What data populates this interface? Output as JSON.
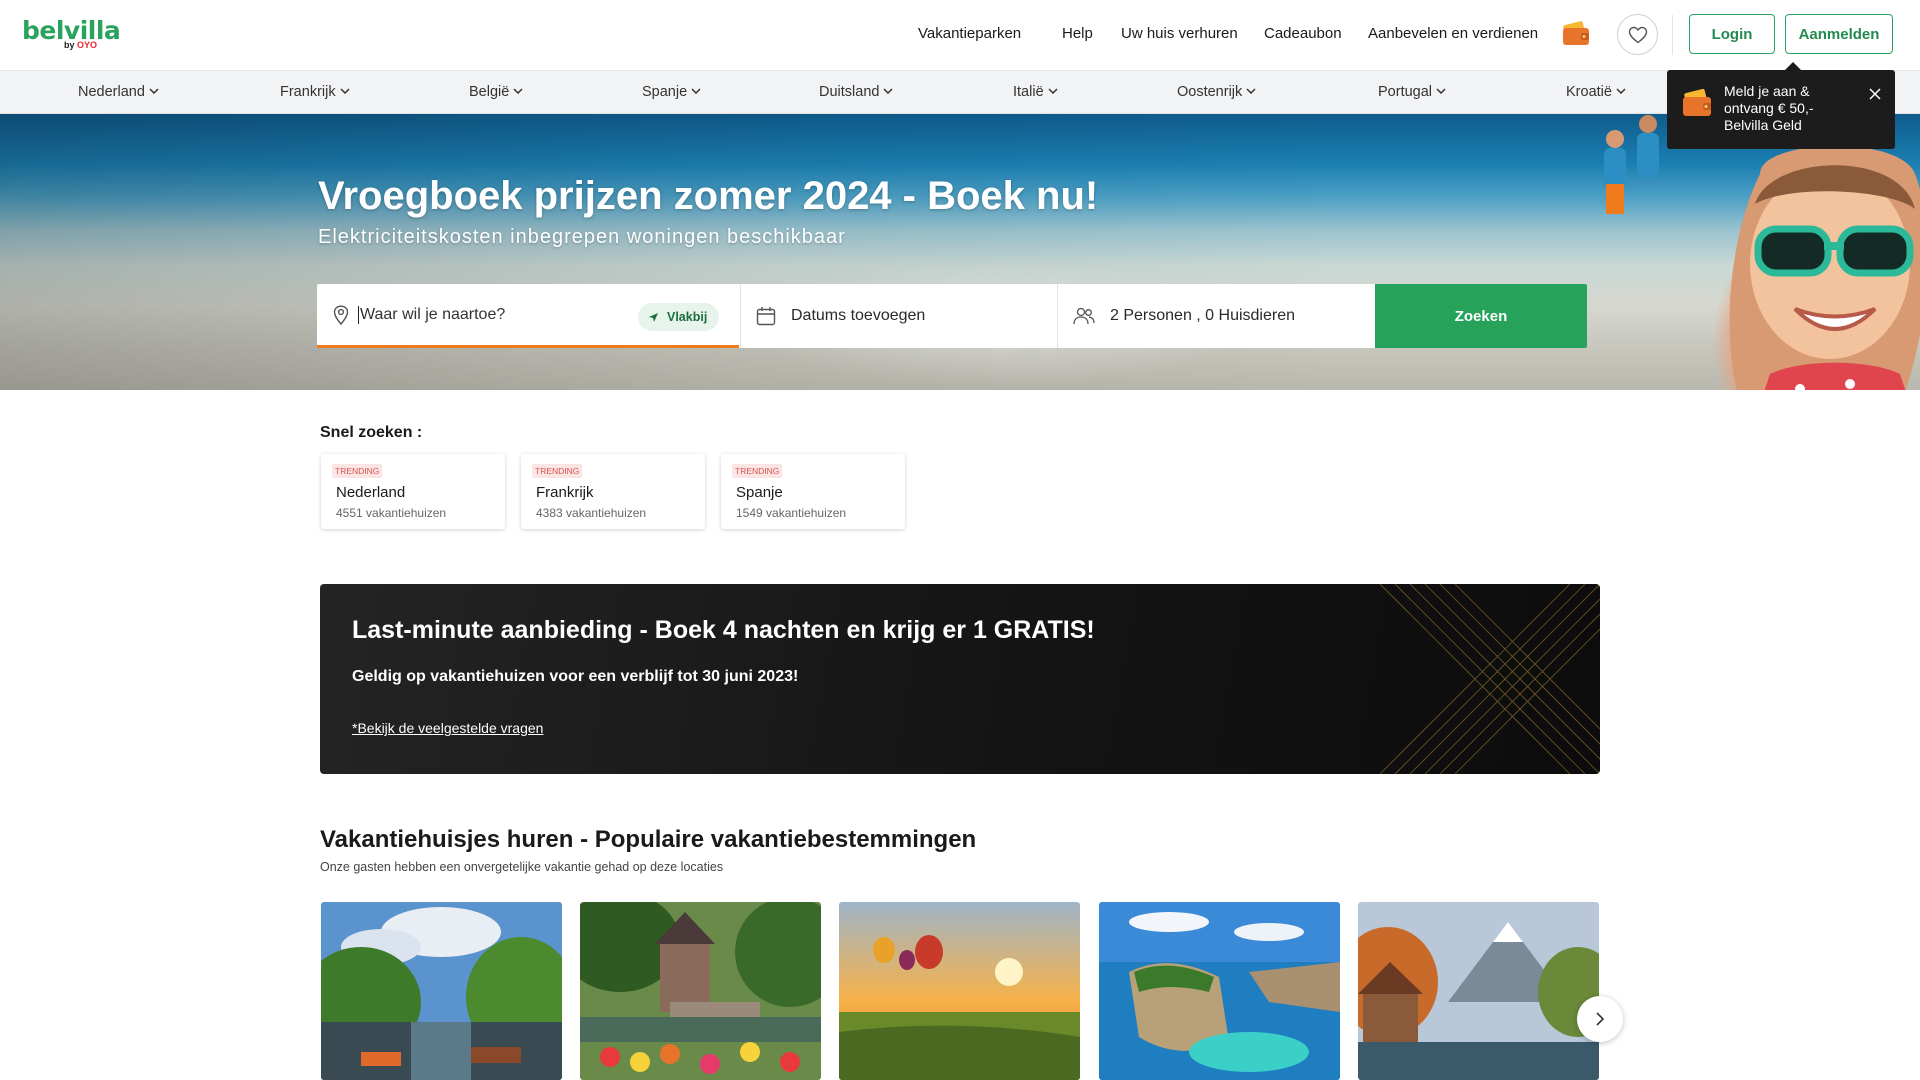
{
  "brand": {
    "name": "belvilla",
    "by": "by",
    "oyo": "OYO",
    "accent": "#2aa35f",
    "oyo_color": "#e8262e"
  },
  "header": {
    "nav": [
      "Vakantieparken",
      "Help",
      "Uw huis verhuren",
      "Cadeaubon",
      "Aanbevelen en verdienen"
    ],
    "login_label": "Login",
    "signup_label": "Aanmelden"
  },
  "countries": [
    "Nederland",
    "Frankrijk",
    "België",
    "Spanje",
    "Duitsland",
    "Italië",
    "Oostenrijk",
    "Portugal",
    "Kroatië"
  ],
  "promo_popup": {
    "text": "Meld je aan & ontvang € 50,- Belvilla Geld"
  },
  "hero": {
    "title": "Vroegboek prijzen zomer 2024 - Boek nu!",
    "subtitle": "Elektriciteitskosten inbegrepen woningen beschikbaar"
  },
  "search": {
    "destination_placeholder": "Waar wil je naartoe?",
    "flexible_chip": "Vlakbij",
    "dates_label": "Datums toevoegen",
    "guests_label": "2 Personen , 0 Huisdieren",
    "submit_label": "Zoeken",
    "button_color": "#27a25a",
    "active_underline_color": "#f07b1d"
  },
  "quick_search": {
    "title": "Snel zoeken :",
    "items": [
      {
        "badge": "TRENDING",
        "name": "Nederland",
        "count": "4551 vakantiehuizen"
      },
      {
        "badge": "TRENDING",
        "name": "Frankrijk",
        "count": "4383 vakantiehuizen"
      },
      {
        "badge": "TRENDING",
        "name": "Spanje",
        "count": "1549 vakantiehuizen"
      }
    ]
  },
  "banner": {
    "title": "Last-minute aanbieding - Boek 4 nachten en krijg er 1 GRATIS!",
    "subtitle": "Geldig op vakantiehuizen voor een verblijf tot 30 juni 2023!",
    "link": "*Bekijk de veelgestelde vragen"
  },
  "popular": {
    "title": "Vakantiehuisjes huren - Populaire vakantiebestemmingen",
    "subtitle": "Onze gasten hebben een onvergetelijke vakantie gehad op deze locaties"
  }
}
